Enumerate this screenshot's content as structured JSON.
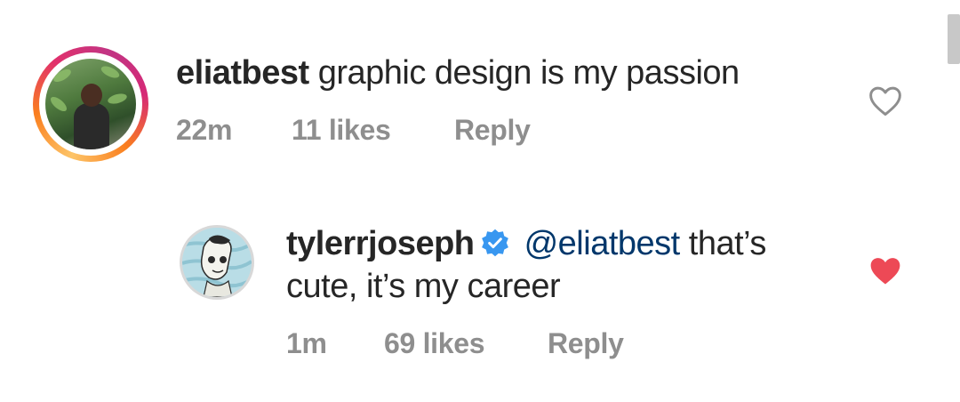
{
  "comments": [
    {
      "username": "eliatbest",
      "text": "graphic design is my passion",
      "time": "22m",
      "likes": "11 likes",
      "reply_label": "Reply",
      "liked": false,
      "has_story_ring": true
    },
    {
      "username": "tylerrjoseph",
      "verified": true,
      "mention": "@eliatbest",
      "text_line1": "that’s",
      "text_line2": "cute, it’s my career",
      "time": "1m",
      "likes": "69 likes",
      "reply_label": "Reply",
      "liked": true
    }
  ],
  "colors": {
    "like_red": "#ed4956",
    "mention_blue": "#00376b",
    "verified_blue": "#3897f0",
    "meta_gray": "#8e8e8e"
  },
  "icons": {
    "like_outline": "heart-outline-icon",
    "like_filled": "heart-filled-icon",
    "verified": "verified-badge-icon"
  }
}
